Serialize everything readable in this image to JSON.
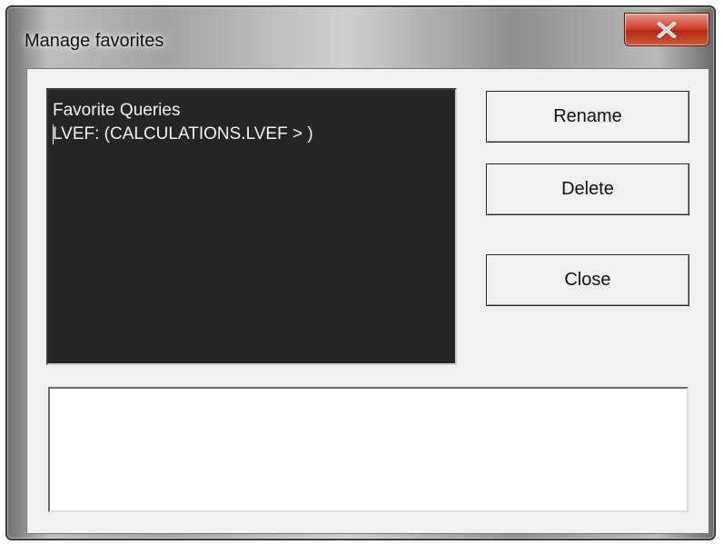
{
  "window": {
    "title": "Manage favorites",
    "close_icon": "close-x-icon"
  },
  "list": {
    "header": "Favorite Queries",
    "items": [
      "LVEF: (CALCULATIONS.LVEF > )"
    ]
  },
  "buttons": {
    "rename": "Rename",
    "delete": "Delete",
    "close": "Close"
  },
  "details": {
    "text": ""
  },
  "colors": {
    "list_bg": "#252525",
    "list_text": "#f2f2f2",
    "close_button": "#c8402a",
    "dialog_bg": "#f0f0f0"
  }
}
